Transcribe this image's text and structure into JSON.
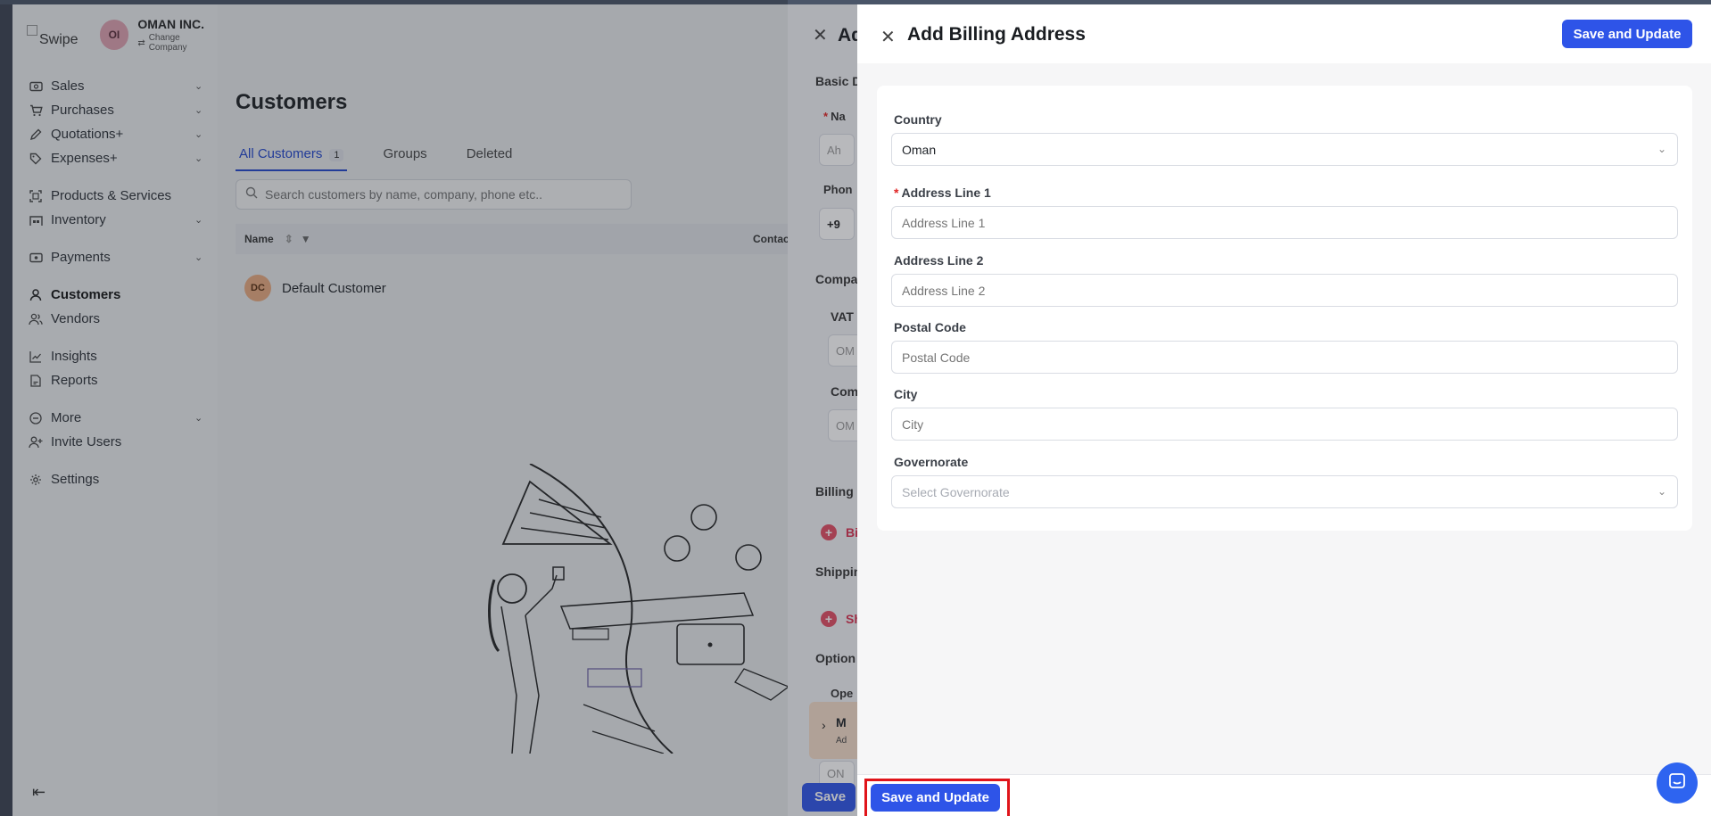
{
  "company": {
    "logo_alt": "Swipe",
    "initials": "OI",
    "name": "OMAN INC.",
    "change_label": "Change Company"
  },
  "sidebar": {
    "items": [
      {
        "label": "Sales",
        "icon": "cash-icon",
        "has_chevron": true
      },
      {
        "label": "Purchases",
        "icon": "cart-icon",
        "has_chevron": true
      },
      {
        "label": "Quotations+",
        "icon": "pen-icon",
        "has_chevron": true
      },
      {
        "label": "Expenses+",
        "icon": "tag-icon",
        "has_chevron": true
      },
      {
        "label": "Products & Services",
        "icon": "scan-icon",
        "has_chevron": false
      },
      {
        "label": "Inventory",
        "icon": "warehouse-icon",
        "has_chevron": true
      },
      {
        "label": "Payments",
        "icon": "money-icon",
        "has_chevron": true
      },
      {
        "label": "Customers",
        "icon": "user-icon",
        "has_chevron": false
      },
      {
        "label": "Vendors",
        "icon": "users-icon",
        "has_chevron": false
      },
      {
        "label": "Insights",
        "icon": "chart-icon",
        "has_chevron": false
      },
      {
        "label": "Reports",
        "icon": "report-icon",
        "has_chevron": false
      },
      {
        "label": "More",
        "icon": "more-icon",
        "has_chevron": true
      },
      {
        "label": "Invite Users",
        "icon": "user-plus-icon",
        "has_chevron": false
      },
      {
        "label": "Settings",
        "icon": "gear-icon",
        "has_chevron": false
      }
    ]
  },
  "customers": {
    "title": "Customers",
    "tabs": [
      {
        "label": "All Customers",
        "count": "1",
        "active": true
      },
      {
        "label": "Groups"
      },
      {
        "label": "Deleted"
      }
    ],
    "search_placeholder": "Search customers by name, company, phone etc..",
    "columns": {
      "name": "Name",
      "contact": "Contact In"
    },
    "rows": [
      {
        "initials": "DC",
        "name": "Default Customer"
      }
    ]
  },
  "customer_drawer": {
    "title": "Ad",
    "sections": {
      "basic": "Basic D",
      "name_label": "Na",
      "name_placeholder": "Ah",
      "phone_label": "Phon",
      "phone_value": "+9",
      "company": "Compa",
      "vat": "VAT",
      "vat_placeholder": "OM",
      "com": "Com",
      "com_placeholder": "OM",
      "billing": "Billing",
      "billing_link": "Bi",
      "shipping": "Shippin",
      "shipping_link": "Sh",
      "optional": "Option",
      "ope": "Ope",
      "m_label": "M",
      "m_sub": "Ad",
      "bottom_ph": "ON"
    },
    "save_label": "Save"
  },
  "billing": {
    "title": "Add Billing Address",
    "save_label": "Save and Update",
    "fields": {
      "country": {
        "label": "Country",
        "value": "Oman"
      },
      "address1": {
        "label": "Address Line 1",
        "placeholder": "Address Line 1"
      },
      "address2": {
        "label": "Address Line 2",
        "placeholder": "Address Line 2"
      },
      "postal": {
        "label": "Postal Code",
        "placeholder": "Postal Code"
      },
      "city": {
        "label": "City",
        "placeholder": "City"
      },
      "governorate": {
        "label": "Governorate",
        "placeholder": "Select Governorate"
      }
    },
    "footer_save_label": "Save and Update"
  },
  "colors": {
    "primary": "#2e54e8",
    "required": "#e02424",
    "highlight": "#e0141a"
  }
}
